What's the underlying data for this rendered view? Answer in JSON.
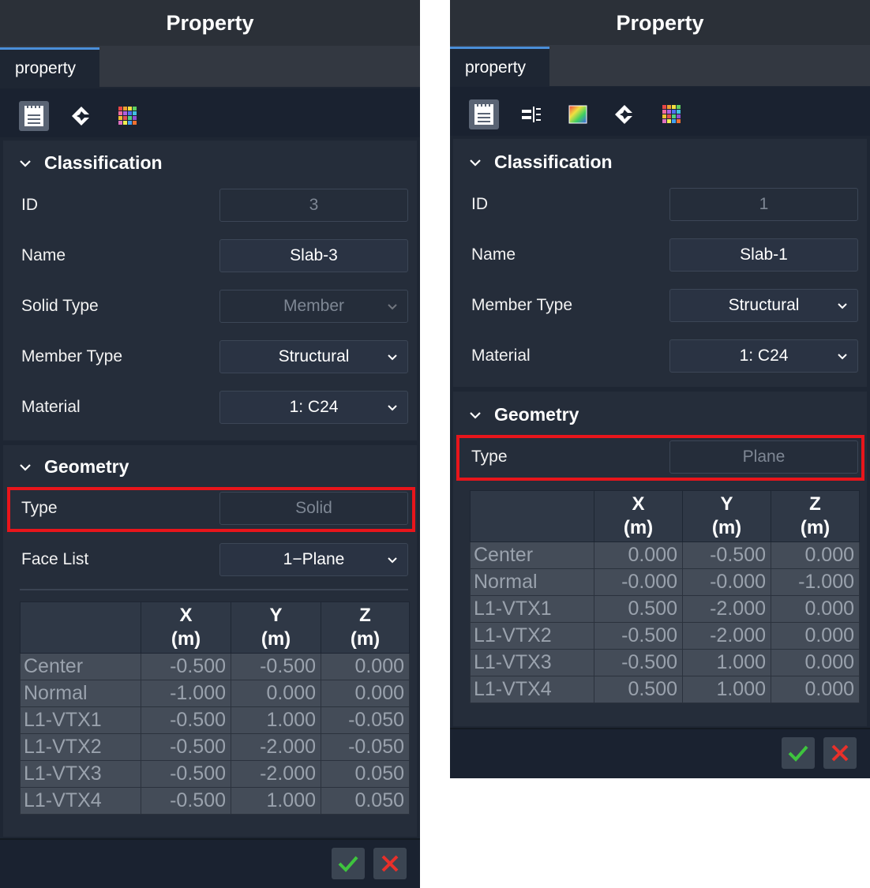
{
  "left": {
    "title": "Property",
    "tab_label": "property",
    "toolbar_icons": [
      "notepad-icon",
      "compass-icon",
      "color-grid-icon"
    ],
    "classification": {
      "header": "Classification",
      "id_label": "ID",
      "id_value": "3",
      "name_label": "Name",
      "name_value": "Slab-3",
      "solid_type_label": "Solid Type",
      "solid_type_value": "Member",
      "member_type_label": "Member Type",
      "member_type_value": "Structural",
      "material_label": "Material",
      "material_value": "1: C24"
    },
    "geometry": {
      "header": "Geometry",
      "type_label": "Type",
      "type_value": "Solid",
      "face_list_label": "Face List",
      "face_list_value": "1−Plane"
    },
    "table": {
      "headers": [
        {
          "axis": "X",
          "unit": "(m)"
        },
        {
          "axis": "Y",
          "unit": "(m)"
        },
        {
          "axis": "Z",
          "unit": "(m)"
        }
      ],
      "rows": [
        {
          "name": "Center",
          "x": "-0.500",
          "y": "-0.500",
          "z": "0.000"
        },
        {
          "name": "Normal",
          "x": "-1.000",
          "y": "0.000",
          "z": "0.000"
        },
        {
          "name": "L1-VTX1",
          "x": "-0.500",
          "y": "1.000",
          "z": "-0.050"
        },
        {
          "name": "L1-VTX2",
          "x": "-0.500",
          "y": "-2.000",
          "z": "-0.050"
        },
        {
          "name": "L1-VTX3",
          "x": "-0.500",
          "y": "-2.000",
          "z": "0.050"
        },
        {
          "name": "L1-VTX4",
          "x": "-0.500",
          "y": "1.000",
          "z": "0.050"
        }
      ]
    }
  },
  "right": {
    "title": "Property",
    "tab_label": "property",
    "toolbar_icons": [
      "notepad-icon",
      "split-align-icon",
      "gradient-icon",
      "compass-icon",
      "color-grid-icon"
    ],
    "classification": {
      "header": "Classification",
      "id_label": "ID",
      "id_value": "1",
      "name_label": "Name",
      "name_value": "Slab-1",
      "member_type_label": "Member Type",
      "member_type_value": "Structural",
      "material_label": "Material",
      "material_value": "1: C24"
    },
    "geometry": {
      "header": "Geometry",
      "type_label": "Type",
      "type_value": "Plane"
    },
    "table": {
      "headers": [
        {
          "axis": "X",
          "unit": "(m)"
        },
        {
          "axis": "Y",
          "unit": "(m)"
        },
        {
          "axis": "Z",
          "unit": "(m)"
        }
      ],
      "rows": [
        {
          "name": "Center",
          "x": "0.000",
          "y": "-0.500",
          "z": "0.000"
        },
        {
          "name": "Normal",
          "x": "-0.000",
          "y": "-0.000",
          "z": "-1.000"
        },
        {
          "name": "L1-VTX1",
          "x": "0.500",
          "y": "-2.000",
          "z": "0.000"
        },
        {
          "name": "L1-VTX2",
          "x": "-0.500",
          "y": "-2.000",
          "z": "0.000"
        },
        {
          "name": "L1-VTX3",
          "x": "-0.500",
          "y": "1.000",
          "z": "0.000"
        },
        {
          "name": "L1-VTX4",
          "x": "0.500",
          "y": "1.000",
          "z": "0.000"
        }
      ]
    }
  },
  "colors": {
    "panel_bg": "#1e2633",
    "section_bg": "#252d3a",
    "highlight": "#e8151b",
    "ok": "#3ec43e",
    "cancel": "#e8302a"
  }
}
